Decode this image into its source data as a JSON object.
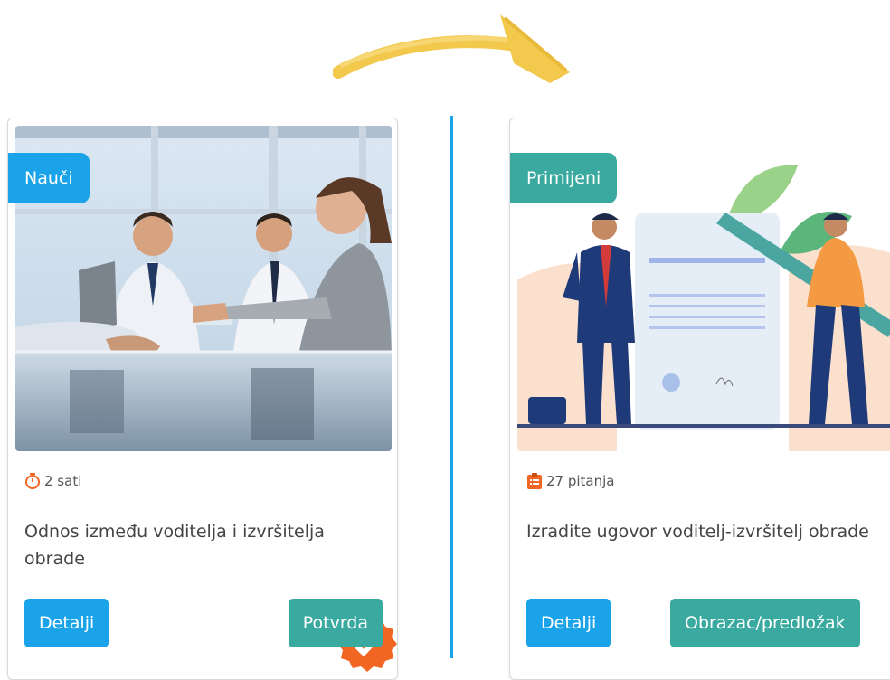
{
  "colors": {
    "accent_blue": "#1aa3e8",
    "accent_teal": "#3aa99f",
    "arrow": "#f2c94c",
    "icon_orange": "#f26522"
  },
  "cards": [
    {
      "tag": "Nauči",
      "image": "business-handshake-photo",
      "completed_icon": "check-badge-icon",
      "meta_icon": "stopwatch-icon",
      "meta": "2 sati",
      "title": "Odnos između voditelja i izvršitelja obrade",
      "primary_button": "Detalji",
      "secondary_button": "Potvrda"
    },
    {
      "tag": "Primijeni",
      "image": "contract-signing-illustration",
      "meta_icon": "clipboard-list-icon",
      "meta": "27 pitanja",
      "title": "Izradite ugovor voditelj-izvršitelj obrade",
      "primary_button": "Detalji",
      "secondary_button": "Obrazac/predložak"
    }
  ]
}
